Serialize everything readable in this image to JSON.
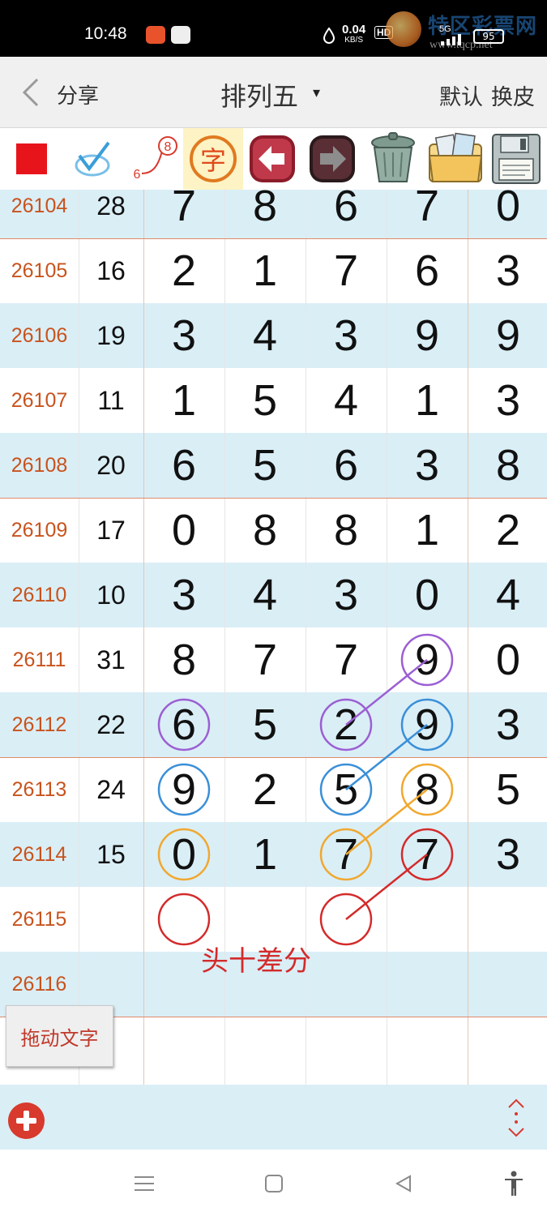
{
  "status_bar": {
    "time": "10:48",
    "net_speed_value": "0.04",
    "net_speed_unit": "KB/S",
    "hd_badge": "HD",
    "signal_label": "5G",
    "battery": "95",
    "watermark_text": "特区彩票网",
    "watermark_url": "www.tqcp.net"
  },
  "header": {
    "back_icon": "chevron-left-icon",
    "share_label": "分享",
    "title": "排列五",
    "title_caret": "▾",
    "default_label": "默认",
    "skin_label": "换皮"
  },
  "toolbar": {
    "tools": [
      {
        "name": "red-square-icon"
      },
      {
        "name": "checkmark-pen-icon"
      },
      {
        "name": "connect-numbers-icon",
        "label_a": "6",
        "label_b": "8"
      },
      {
        "name": "text-tool-icon",
        "label": "字"
      },
      {
        "name": "undo-arrow-icon"
      },
      {
        "name": "redo-arrow-icon"
      },
      {
        "name": "trash-can-icon"
      },
      {
        "name": "photo-folder-icon"
      },
      {
        "name": "save-disk-icon"
      }
    ]
  },
  "table": {
    "rows": [
      {
        "issue": "26104",
        "sum": "28",
        "digits": [
          "7",
          "8",
          "6",
          "7",
          "0"
        ]
      },
      {
        "issue": "26105",
        "sum": "16",
        "digits": [
          "2",
          "1",
          "7",
          "6",
          "3"
        ]
      },
      {
        "issue": "26106",
        "sum": "19",
        "digits": [
          "3",
          "4",
          "3",
          "9",
          "9"
        ]
      },
      {
        "issue": "26107",
        "sum": "11",
        "digits": [
          "1",
          "5",
          "4",
          "1",
          "3"
        ]
      },
      {
        "issue": "26108",
        "sum": "20",
        "digits": [
          "6",
          "5",
          "6",
          "3",
          "8"
        ]
      },
      {
        "issue": "26109",
        "sum": "17",
        "digits": [
          "0",
          "8",
          "8",
          "1",
          "2"
        ]
      },
      {
        "issue": "26110",
        "sum": "10",
        "digits": [
          "3",
          "4",
          "3",
          "0",
          "4"
        ]
      },
      {
        "issue": "26111",
        "sum": "31",
        "digits": [
          "8",
          "7",
          "7",
          "9",
          "0"
        ]
      },
      {
        "issue": "26112",
        "sum": "22",
        "digits": [
          "6",
          "5",
          "2",
          "9",
          "3"
        ]
      },
      {
        "issue": "26113",
        "sum": "24",
        "digits": [
          "9",
          "2",
          "5",
          "8",
          "5"
        ]
      },
      {
        "issue": "26114",
        "sum": "15",
        "digits": [
          "0",
          "1",
          "7",
          "7",
          "3"
        ]
      },
      {
        "issue": "26115",
        "sum": "",
        "digits": [
          "",
          "",
          "",
          "",
          ""
        ]
      },
      {
        "issue": "26116",
        "sum": "",
        "digits": [
          "",
          "",
          "",
          "",
          ""
        ]
      },
      {
        "issue": "",
        "sum": "",
        "digits": [
          "",
          "",
          "",
          "",
          ""
        ]
      }
    ]
  },
  "annotations": {
    "colors": {
      "purple": "#9b5fd3",
      "blue": "#3a8fd8",
      "orange": "#f0a830",
      "red": "#d32b2b"
    },
    "text": "头十差分"
  },
  "drag_text_button": "拖动文字",
  "bottom_bar": {
    "add_icon": "plus-circle-icon",
    "resize_icon": "vertical-resize-icon"
  },
  "nav_bar": {
    "menu_icon": "menu-icon",
    "home_icon": "home-square-icon",
    "back_icon": "triangle-back-icon",
    "accessibility_icon": "accessibility-icon"
  }
}
